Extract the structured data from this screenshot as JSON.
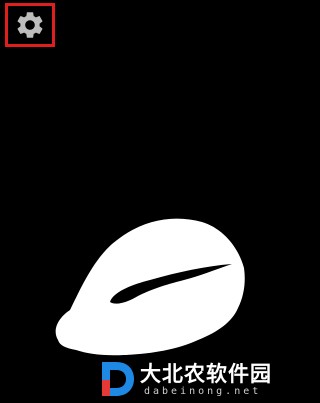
{
  "toolbar": {
    "settings_icon": "gear-icon",
    "highlight_color": "#e01e1e",
    "icon_color": "#bdbdbd"
  },
  "canvas": {
    "background": "#000000",
    "shape_color": "#ffffff"
  },
  "watermark": {
    "logo_letter": "D",
    "name_cn": "大北农软件园",
    "site": "dabeinong.net",
    "logo_colors": [
      "#1e88e5",
      "#e53935"
    ]
  }
}
